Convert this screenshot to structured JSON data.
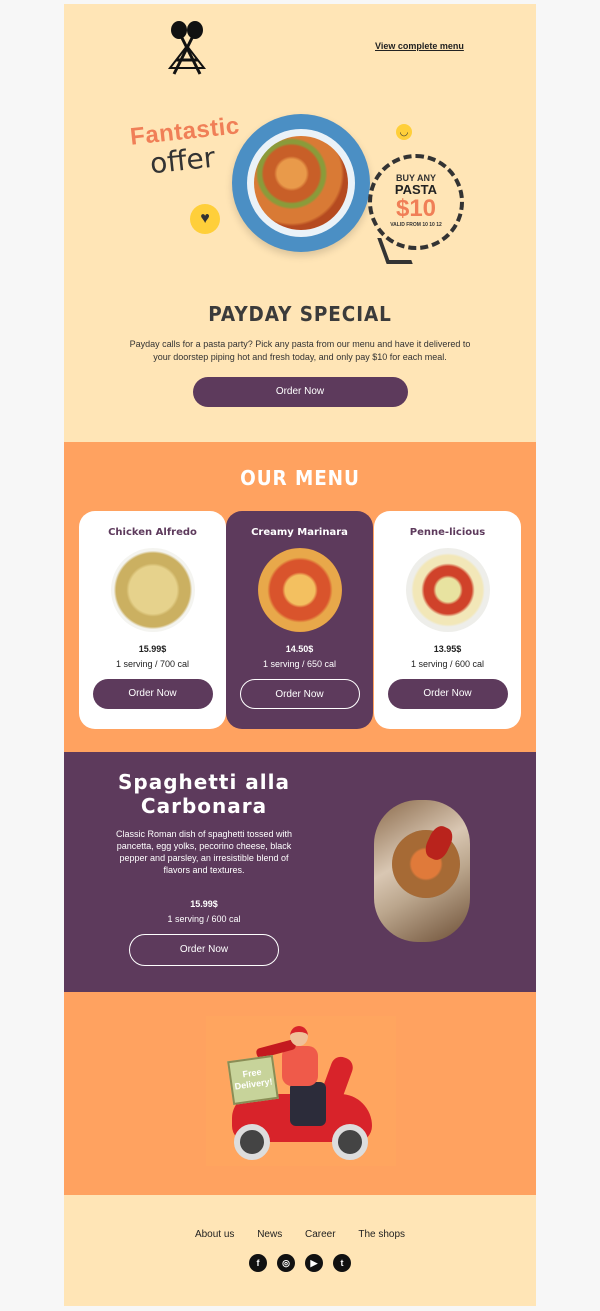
{
  "header": {
    "view_menu": "View complete menu"
  },
  "hero": {
    "headline_1": "Fantastic",
    "headline_2": "offer",
    "bubble_line1": "BUY ANY",
    "bubble_line2": "PASTA",
    "bubble_price": "$10",
    "bubble_valid": "VALID FROM 10 10 12"
  },
  "payday": {
    "title": "PAYDAY SPECIAL",
    "body": "Payday calls for a pasta party? Pick any pasta from our menu and have it delivered to your doorstep piping hot and fresh today, and only pay $10 for each meal.",
    "cta": "Order Now"
  },
  "menu": {
    "title": "OUR MENU",
    "items": [
      {
        "name": "Chicken Alfredo",
        "price": "15.99$",
        "details": "1 serving / 700 cal",
        "cta": "Order Now"
      },
      {
        "name": "Creamy Marinara",
        "price": "14.50$",
        "details": "1 serving / 650 cal",
        "cta": "Order Now"
      },
      {
        "name": "Penne-licious",
        "price": "13.95$",
        "details": "1 serving / 600 cal",
        "cta": "Order Now"
      }
    ]
  },
  "feature": {
    "title": "Spaghetti alla Carbonara",
    "description": "Classic Roman dish of spaghetti tossed with pancetta, egg yolks, pecorino cheese, black pepper and parsley, an irresistible blend of flavors and textures.",
    "price": "15.99$",
    "details": "1 serving / 600 cal",
    "cta": "Order Now"
  },
  "delivery": {
    "box_text": "Free Delivery!"
  },
  "footer": {
    "links": [
      "About us",
      "News",
      "Career",
      "The shops"
    ],
    "socials": [
      "facebook-icon",
      "instagram-icon",
      "youtube-icon",
      "twitter-icon"
    ]
  },
  "colors": {
    "cream": "#ffe5b6",
    "orange": "#ffa260",
    "purple": "#5d3a5c",
    "accent": "#f07f57"
  }
}
